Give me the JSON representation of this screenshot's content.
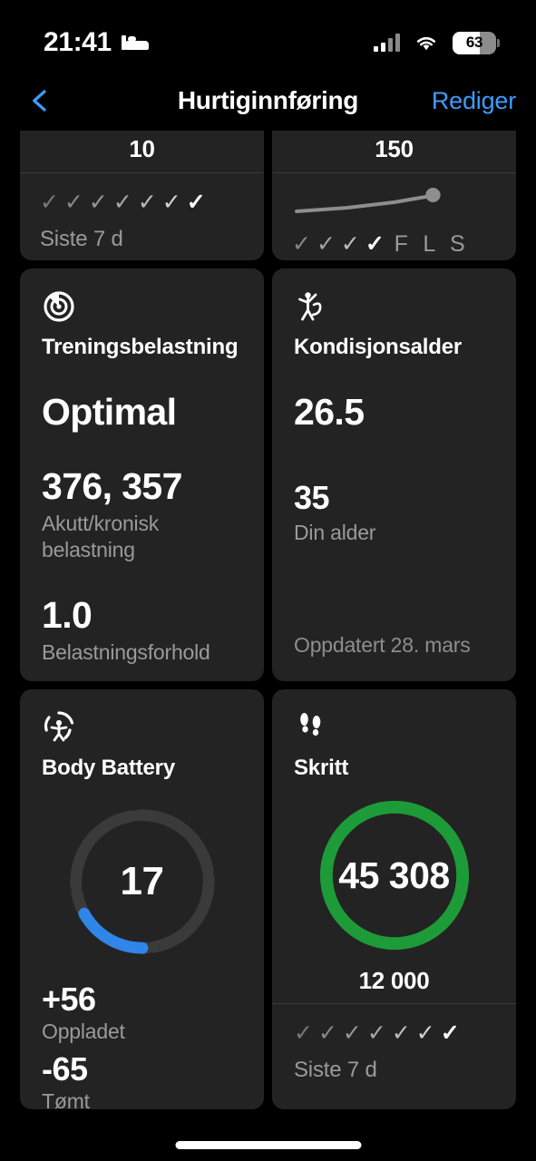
{
  "status_bar": {
    "time": "21:41",
    "bed_icon": "bed-icon",
    "signal_icon": "cellular-signal-icon",
    "signal_bars_filled": 2,
    "wifi_icon": "wifi-icon",
    "battery_level": "63",
    "battery_percent": 63
  },
  "header": {
    "back_icon": "chevron-left-icon",
    "title": "Hurtiginnføring",
    "edit_label": "Rediger"
  },
  "cards": {
    "clipped_left": {
      "value": "10",
      "checks": 7,
      "footer": "Siste 7 d"
    },
    "clipped_right": {
      "value": "150",
      "checks": 4,
      "day_letters": [
        "F",
        "L",
        "S"
      ],
      "sparkline": [
        8,
        12,
        20,
        28,
        34,
        38
      ]
    },
    "training_load": {
      "icon": "training-load-target-icon",
      "title": "Treningsbelastning",
      "status": "Optimal",
      "acute_chronic_value": "376, 357",
      "acute_chronic_label": "Akutt/kronisk belastning",
      "ratio_value": "1.0",
      "ratio_label": "Belastningsforhold"
    },
    "fitness_age": {
      "icon": "person-fitness-icon",
      "title": "Kondisjonsalder",
      "fitness_age": "26.5",
      "your_age": "35",
      "your_age_label": "Din alder",
      "updated": "Oppdatert 28. mars"
    },
    "body_battery": {
      "icon": "body-battery-icon",
      "title": "Body Battery",
      "gauge_value": "17",
      "gauge_percent": 17,
      "charged_value": "+56",
      "charged_label": "Oppladet",
      "drained_value": "-65",
      "drained_label": "Tømt",
      "arc_color": "#2f85e8",
      "track_color": "#3a3a3a"
    },
    "steps": {
      "icon": "footprints-icon",
      "title": "Skritt",
      "ring_value": "45 308",
      "goal": "12 000",
      "ring_percent": 100,
      "ring_color": "#1d9b38",
      "checks": 7,
      "footer": "Siste 7 d"
    }
  },
  "theme": {
    "background": "#000000",
    "card_background": "#232323",
    "accent_blue": "#3d9cfc",
    "green": "#1d9b38",
    "muted_text": "#9a9a9a"
  },
  "home_indicator": "home-indicator"
}
